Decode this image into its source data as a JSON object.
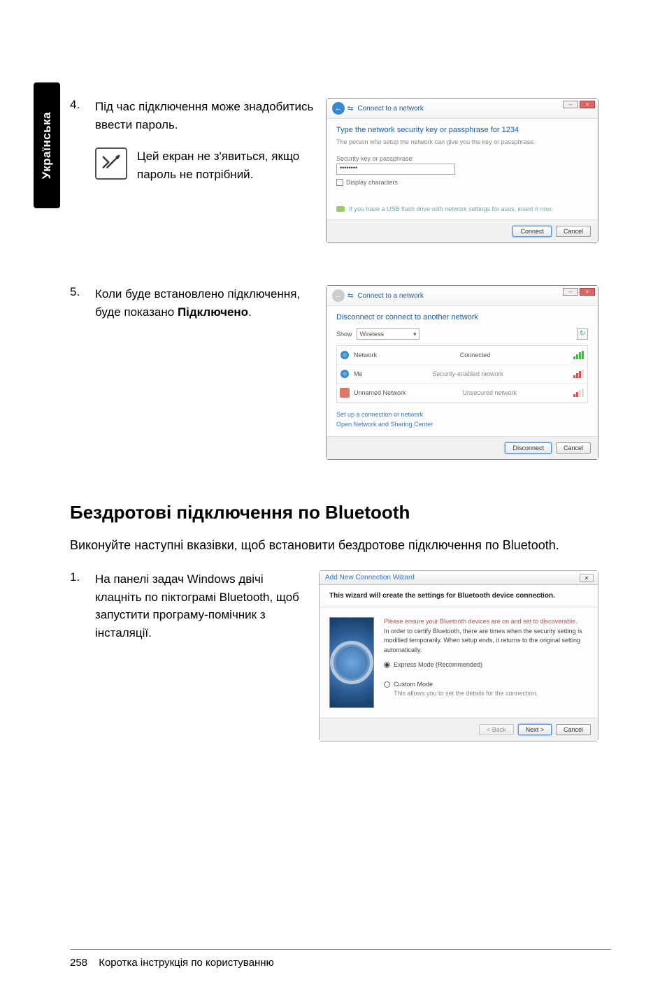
{
  "side_tab": "Українська",
  "step4": {
    "num": "4.",
    "text": "Під час підключення може знадобитись ввести пароль.",
    "note": "Цей екран не з'явиться, якщо пароль не потрібний."
  },
  "dialog4": {
    "window_title": "Connect to a network",
    "heading": "Type the network security key or passphrase for 1234",
    "sub": "The person who setup the network can give you the key or passphrase.",
    "field_label": "Security key or passphrase:",
    "input_value": "••••••••",
    "checkbox": "Display characters",
    "hint": "If you have a USB flash drive with network settings for asus, insert it now.",
    "btn_connect": "Connect",
    "btn_cancel": "Cancel"
  },
  "step5": {
    "num": "5.",
    "text_pre": "Коли буде встановлено підключення, буде показано ",
    "text_bold": "Підключено",
    "text_post": "."
  },
  "dialog5": {
    "window_title": "Connect to a network",
    "heading": "Disconnect or connect to another network",
    "show_label": "Show",
    "show_value": "Wireless",
    "rows": [
      {
        "name": "Network",
        "status": "Connected"
      },
      {
        "name": "Me",
        "status": "Security-enabled network"
      },
      {
        "name": "Unnamed Network",
        "status": "Unsecured network"
      }
    ],
    "link1": "Set up a connection or network",
    "link2": "Open Network and Sharing Center",
    "btn_disconnect": "Disconnect",
    "btn_cancel": "Cancel"
  },
  "bt_heading": "Бездротові підключення по Bluetooth",
  "bt_para": "Виконуйте наступні вказівки, щоб встановити бездротове підключення по Bluetooth.",
  "step1": {
    "num": "1.",
    "text": "На панелі задач Windows двічі клацніть по піктограмі Bluetooth, щоб запустити програму-помічник з інсталяції."
  },
  "wizard": {
    "title": "Add New Connection Wizard",
    "banner": "This wizard will create the settings for Bluetooth device connection.",
    "warn": "Please ensure your Bluetooth devices are on and set to discoverable.",
    "desc": "In order to certify Bluetooth, there are times when the security setting is modified temporarily. When setup ends, it returns to the original setting automatically.",
    "opt_express": "Express Mode (Recommended)",
    "opt_custom": "Custom Mode",
    "custom_desc": "This allows you to set the details for the connection.",
    "btn_back": "< Back",
    "btn_next": "Next >",
    "btn_cancel": "Cancel"
  },
  "footer": {
    "page": "258",
    "title": "Коротка інструкція по користуванню"
  }
}
